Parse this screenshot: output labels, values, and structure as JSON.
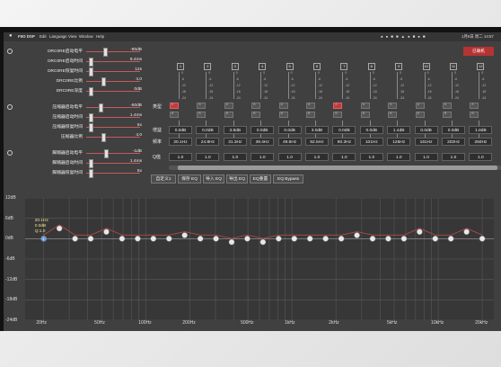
{
  "menubar": {
    "app_name": "FIIO DSP",
    "items": [
      "Edit",
      "Language",
      "View",
      "Window",
      "Help"
    ],
    "datetime": "1月6日 周二 14:57"
  },
  "left_panel": {
    "rows": [
      {
        "label": "DRC0RE启动电平",
        "value": "-80dB",
        "pos": 0.32
      },
      {
        "label": "DRC0RE启动时间",
        "value": "8.4ms",
        "pos": 0.05
      },
      {
        "label": "DRC0RE恢复时间",
        "value": "12s",
        "pos": 0.05
      },
      {
        "label": "DRC0RE比例",
        "value": "4.0",
        "pos": 0.28
      },
      {
        "label": "DRC0RE深度",
        "value": "0dB",
        "pos": 0.05
      },
      {
        "label": "压缩器启动电平",
        "value": "-50dB",
        "pos": 0.24
      },
      {
        "label": "压缩器启动时间",
        "value": "1.4ms",
        "pos": 0.05
      },
      {
        "label": "压缩器恢复时间",
        "value": "5x",
        "pos": 0.05
      },
      {
        "label": "压缩器比例",
        "value": "4.0",
        "pos": 0.28
      },
      {
        "label": "脚踏器启动电平",
        "value": "-1dB",
        "pos": 0.34
      },
      {
        "label": "脚踏器启动时间",
        "value": "1.4ms",
        "pos": 0.05
      },
      {
        "label": "脚踏器恢复时间",
        "value": "5x",
        "pos": 0.05
      }
    ]
  },
  "top_right_button": "已联机",
  "channels": {
    "numbers": [
      "1",
      "2",
      "3",
      "4",
      "5",
      "6",
      "7",
      "8",
      "9",
      "10",
      "11",
      "12"
    ],
    "scale_labels": [
      "0",
      "-6",
      "-12",
      "-18",
      "-24"
    ],
    "toggle_labels": [
      "A",
      "B"
    ],
    "active_channels": [
      0,
      6
    ]
  },
  "eq_table": {
    "rows": [
      {
        "label": "类型",
        "values": [
          "",
          "",
          "",
          "",
          "",
          "",
          "",
          "",
          "",
          "",
          "",
          ""
        ]
      },
      {
        "label": "增益",
        "values": [
          "0.0dB",
          "0.0dB",
          "3.8dB",
          "0.0dB",
          "0.0dB",
          "3.0dB",
          "0.0dB",
          "0.0dB",
          "1.4dB",
          "0.0dB",
          "0.0dB",
          "1.8dB"
        ]
      },
      {
        "label": "频率",
        "values": [
          "20.1Hz",
          "24.8Hz",
          "31.3Hz",
          "39.4Hz",
          "49.6Hz",
          "62.5Hz",
          "80.3Hz",
          "101Hz",
          "125Hz",
          "161Hz",
          "202Hz",
          "250Hz"
        ]
      },
      {
        "label": "Q值",
        "values": [
          "1.0",
          "1.0",
          "1.0",
          "1.0",
          "1.0",
          "1.0",
          "1.0",
          "1.0",
          "1.0",
          "1.0",
          "1.0",
          "1.0"
        ]
      }
    ]
  },
  "toolbar": {
    "buttons": [
      "自定义1",
      "保存 EQ",
      "导入 EQ",
      "导出 EQ",
      "EQ重置",
      "EQ Bypass"
    ]
  },
  "eq_graph": {
    "y_ticks": [
      "12dB",
      "6dB",
      "0dB",
      "-6dB",
      "-12dB",
      "-18dB",
      "-24dB"
    ],
    "x_ticks": [
      "20Hz",
      "50Hz",
      "100Hz",
      "200Hz",
      "500Hz",
      "1kHz",
      "2kHz",
      "5kHz",
      "10kHz",
      "20kHz"
    ],
    "tooltip": [
      "20.1Hz",
      "0.0dB",
      "Q:1.0"
    ],
    "selected_band": "1",
    "bands_gain_db": [
      0,
      3,
      0,
      0,
      2,
      0,
      0,
      0,
      0,
      1,
      0,
      0,
      -1,
      0,
      -1,
      0,
      0,
      0,
      0,
      0,
      1,
      0,
      0,
      0,
      2,
      0,
      0,
      2,
      0
    ],
    "colors": {
      "accent": "#c23a3a",
      "curve": "#b04848",
      "selected": "#6b9ee0"
    }
  }
}
